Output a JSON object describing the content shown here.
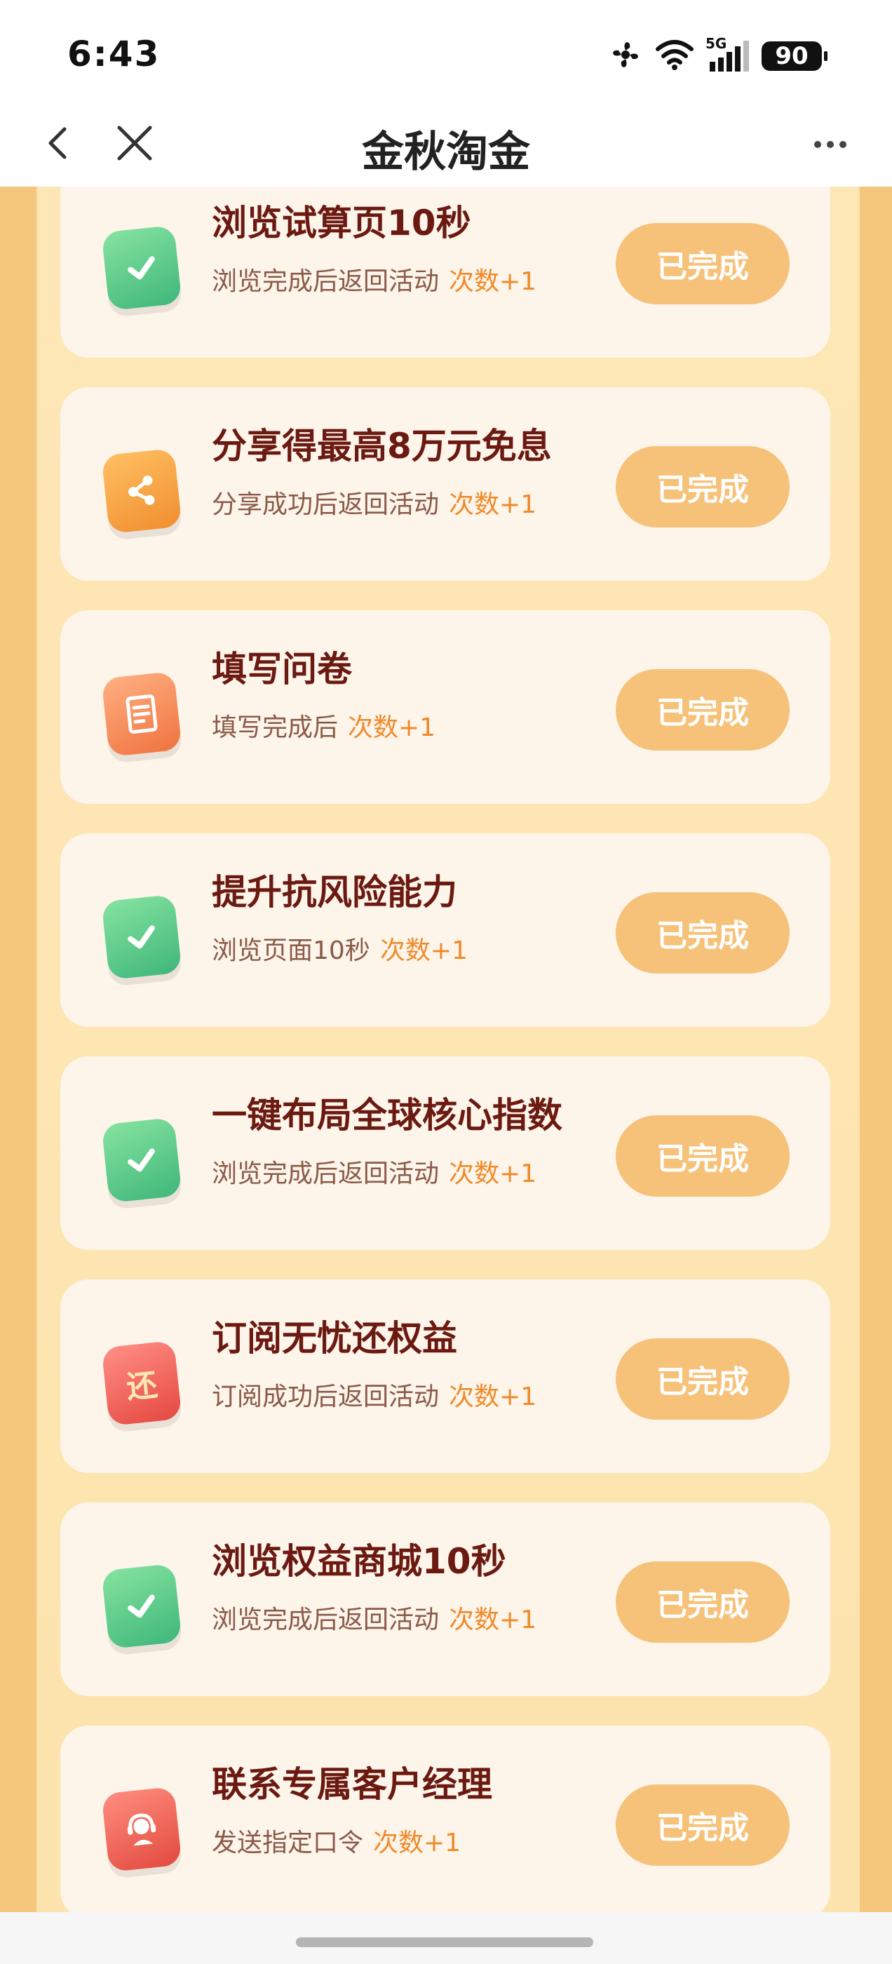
{
  "status_bar": {
    "time": "6:43",
    "battery": "90",
    "icons": [
      "fan-icon",
      "wifi-icon",
      "signal-5g-icon",
      "battery-icon"
    ],
    "network": "5G"
  },
  "nav": {
    "title": "金秋淘金",
    "back_icon": "chevron-left-icon",
    "close_icon": "close-icon",
    "more_icon": "more-icon"
  },
  "tasks": [
    {
      "title": "浏览试算页10秒",
      "subtitle": "浏览完成后返回活动",
      "count": "次数+1",
      "button": "已完成",
      "icon": "check-icon"
    },
    {
      "title": "分享得最高8万元免息",
      "subtitle": "分享成功后返回活动",
      "count": "次数+1",
      "button": "已完成",
      "icon": "share-icon"
    },
    {
      "title": "填写问卷",
      "subtitle": "填写完成后",
      "count": "次数+1",
      "button": "已完成",
      "icon": "survey-icon"
    },
    {
      "title": "提升抗风险能力",
      "subtitle": "浏览页面10秒",
      "count": "次数+1",
      "button": "已完成",
      "icon": "check-icon"
    },
    {
      "title": "一键布局全球核心指数",
      "subtitle": "浏览完成后返回活动",
      "count": "次数+1",
      "button": "已完成",
      "icon": "check-icon"
    },
    {
      "title": "订阅无忧还权益",
      "subtitle": "订阅成功后返回活动",
      "count": "次数+1",
      "button": "已完成",
      "icon": "huan-icon",
      "icon_text": "还"
    },
    {
      "title": "浏览权益商城10秒",
      "subtitle": "浏览完成后返回活动",
      "count": "次数+1",
      "button": "已完成",
      "icon": "check-icon"
    },
    {
      "title": "联系专属客户经理",
      "subtitle": "发送指定口令",
      "count": "次数+1",
      "button": "已完成",
      "icon": "customer-service-icon"
    }
  ],
  "colors": {
    "page_bg": "#f5c77c",
    "panel_bg": "#fde7b6",
    "card_bg": "#fdf4ea",
    "title": "#6b1a12",
    "count": "#f08a2a",
    "button": "#f6c27a"
  }
}
